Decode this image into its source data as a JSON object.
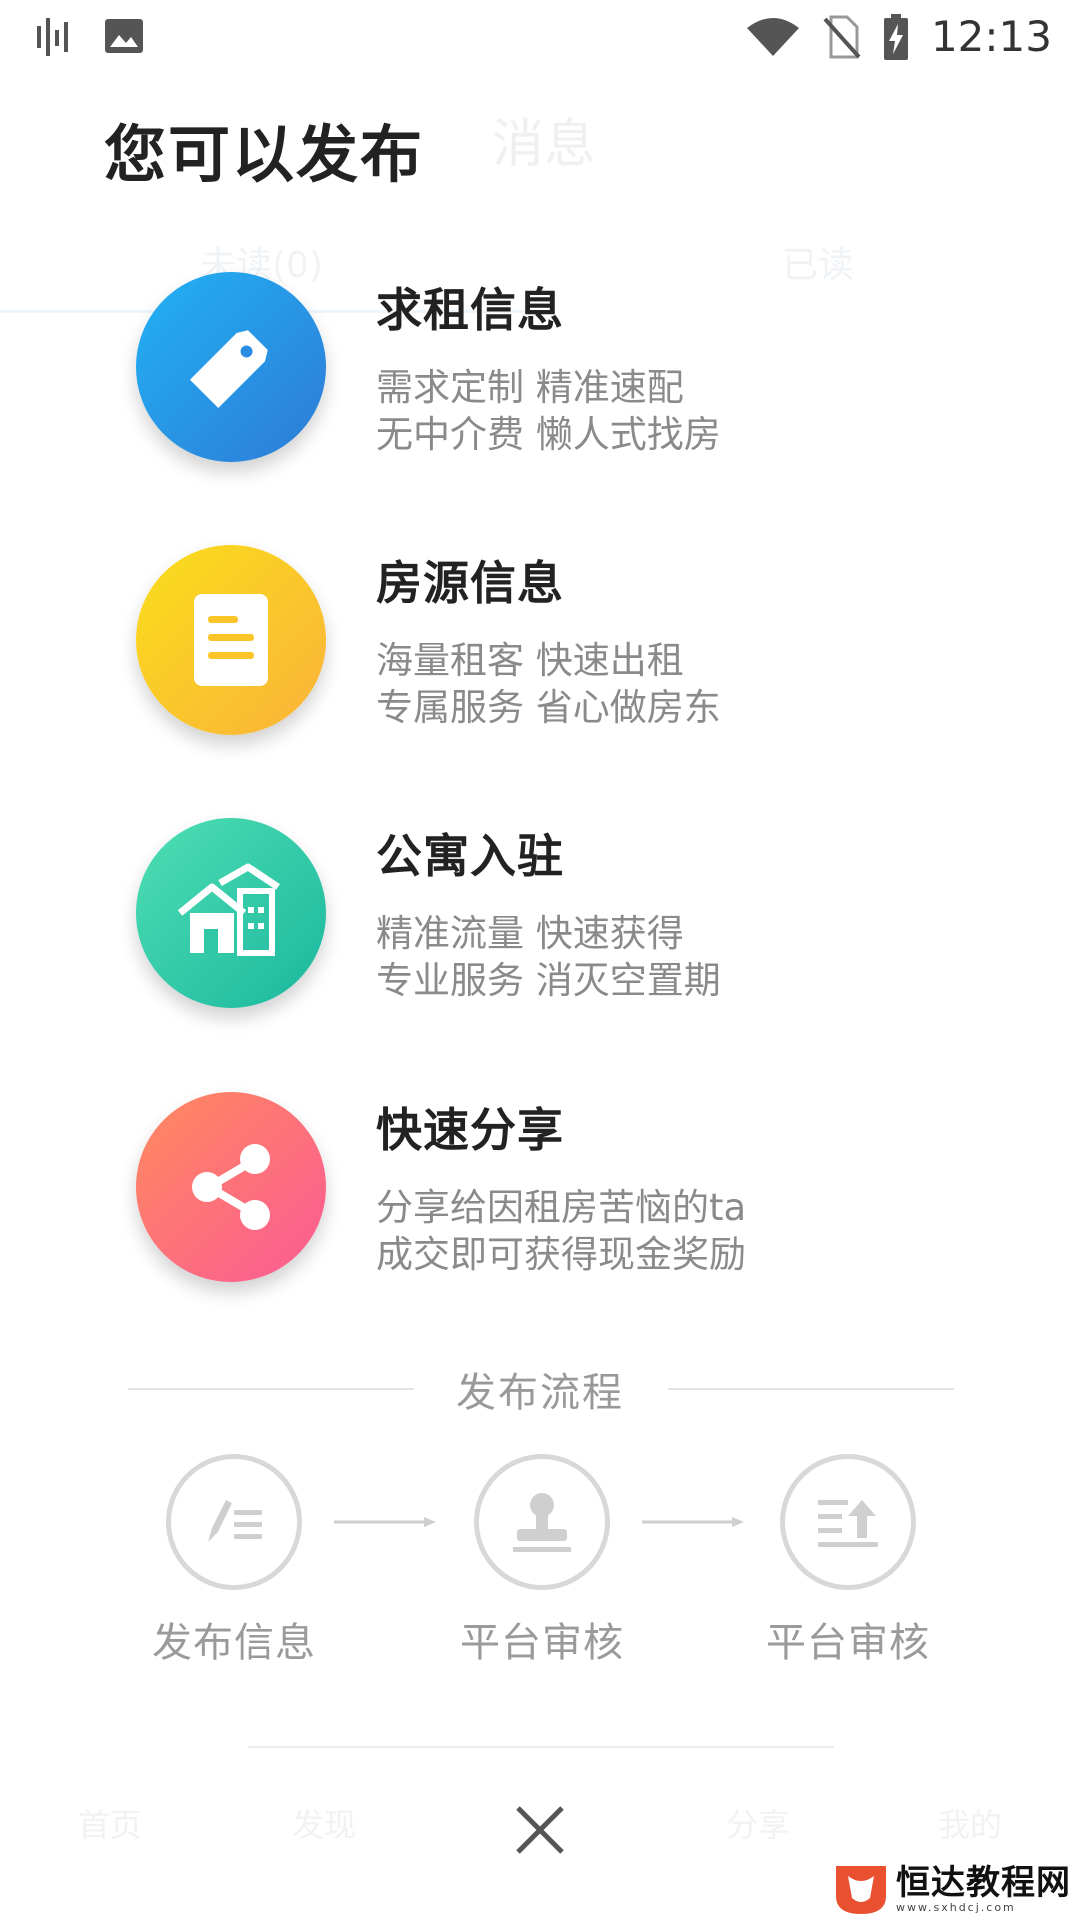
{
  "status_bar": {
    "time": "12:13",
    "icons": [
      "signal-bars-icon",
      "image-icon",
      "wifi-icon",
      "no-sim-icon",
      "battery-charging-icon"
    ]
  },
  "background": {
    "title": "消息",
    "tabs": [
      "未读(0)",
      "已读"
    ],
    "nav": [
      "首页",
      "发现",
      "分享",
      "我的"
    ]
  },
  "sheet": {
    "title": "您可以发布",
    "options": [
      {
        "title": "求租信息",
        "desc1": "需求定制 精准速配",
        "desc2": "无中介费 懒人式找房",
        "icon": "tag-icon",
        "color": "#2a8de3"
      },
      {
        "title": "房源信息",
        "desc1": "海量租客 快速出租",
        "desc2": "专属服务 省心做房东",
        "icon": "document-icon",
        "color": "#fbc52a"
      },
      {
        "title": "公寓入驻",
        "desc1": "精准流量 快速获得",
        "desc2": "专业服务 消灭空置期",
        "icon": "apartment-icon",
        "color": "#2fc7a6"
      },
      {
        "title": "快速分享",
        "desc1": "分享给因租房苦恼的ta",
        "desc2": "成交即可获得现金奖励",
        "icon": "share-icon",
        "color": "#fd6f7c"
      }
    ]
  },
  "process": {
    "title": "发布流程",
    "steps": [
      {
        "label": "发布信息",
        "icon": "edit-list-icon"
      },
      {
        "label": "平台审核",
        "icon": "stamp-icon"
      },
      {
        "label": "平台审核",
        "icon": "upload-list-icon"
      }
    ]
  },
  "close": {
    "icon": "close-icon"
  },
  "watermark": {
    "main": "恒达教程网",
    "sub": "www.sxhdcj.com"
  }
}
